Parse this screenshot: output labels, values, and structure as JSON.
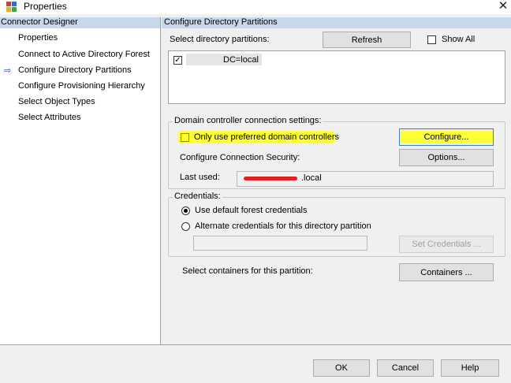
{
  "window": {
    "title": "Properties",
    "close_glyph": "✕",
    "icon": "properties-app-icon"
  },
  "left_panel": {
    "header": "Connector Designer",
    "items": [
      {
        "label": "Properties",
        "selected": false
      },
      {
        "label": "Connect to Active Directory Forest",
        "selected": false
      },
      {
        "label": "Configure Directory Partitions",
        "selected": true
      },
      {
        "label": "Configure Provisioning Hierarchy",
        "selected": false
      },
      {
        "label": "Select Object Types",
        "selected": false
      },
      {
        "label": "Select Attributes",
        "selected": false
      }
    ],
    "selected_arrow": "⇨"
  },
  "right_panel": {
    "header": "Configure Directory Partitions",
    "select_partitions_label": "Select directory partitions:",
    "refresh_button": "Refresh",
    "show_all_label": "Show All",
    "show_all_checked": false,
    "partitions": [
      {
        "name": "DC=local",
        "checked": true
      }
    ],
    "dc_settings": {
      "group_title": "Domain controller connection settings:",
      "preferred_label": "Only use preferred domain controllers",
      "preferred_checked": false,
      "configure_button": "Configure...",
      "security_label": "Configure Connection Security:",
      "options_button": "Options...",
      "last_used_label": "Last used:",
      "last_used_value": ".local"
    },
    "credentials": {
      "group_title": "Credentials:",
      "default_label": "Use default forest credentials",
      "alternate_label": "Alternate credentials for this directory partition",
      "selected": "default",
      "alternate_value": "",
      "set_credentials_button": "Set Credentials ..."
    },
    "containers_label": "Select containers for this partition:",
    "containers_button": "Containers ..."
  },
  "footer": {
    "ok_button": "OK",
    "cancel_button": "Cancel",
    "help_button": "Help"
  },
  "colors": {
    "panel_header": "#c7d8ec",
    "highlight": "#ffff38",
    "redaction": "#e02020",
    "primary_border": "#3c7fb1"
  }
}
